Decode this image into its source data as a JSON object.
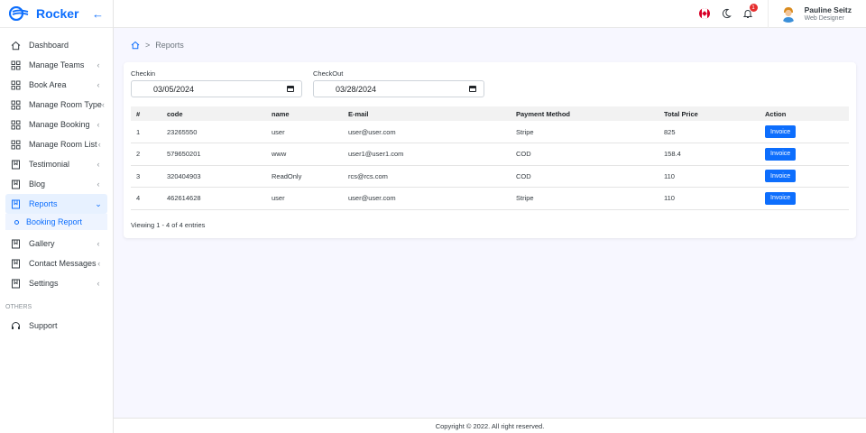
{
  "brand": {
    "name": "Rocker",
    "color": "#0d6efd"
  },
  "sidebar": {
    "items": [
      {
        "label": "Dashboard",
        "icon": "home-icon",
        "arrow": false
      },
      {
        "label": "Manage Teams",
        "icon": "grid-icon",
        "arrow": true
      },
      {
        "label": "Book Area",
        "icon": "grid-icon",
        "arrow": true
      },
      {
        "label": "Manage Room Type",
        "icon": "grid-icon",
        "arrow": true
      },
      {
        "label": "Manage Booking",
        "icon": "grid-icon",
        "arrow": true
      },
      {
        "label": "Manage Room List",
        "icon": "grid-icon",
        "arrow": true
      },
      {
        "label": "Testimonial",
        "icon": "bookmark-icon",
        "arrow": true
      },
      {
        "label": "Blog",
        "icon": "bookmark-icon",
        "arrow": true
      },
      {
        "label": "Reports",
        "icon": "bookmark-icon",
        "arrow": true,
        "active": true
      },
      {
        "label": "Gallery",
        "icon": "bookmark-icon",
        "arrow": true
      },
      {
        "label": "Contact Messages",
        "icon": "bookmark-icon",
        "arrow": true
      },
      {
        "label": "Settings",
        "icon": "bookmark-icon",
        "arrow": true
      }
    ],
    "submenu": {
      "label": "Booking Report"
    },
    "section_label": "OTHERS",
    "support": {
      "label": "Support",
      "icon": "headset-icon"
    }
  },
  "topbar": {
    "notification_count": "1",
    "user": {
      "name": "Pauline Seitz",
      "role": "Web Designer"
    }
  },
  "breadcrumb": {
    "current": "Reports"
  },
  "filters": {
    "checkin": {
      "label": "Checkin",
      "value": "03/05/2024"
    },
    "checkout": {
      "label": "CheckOut",
      "value": "03/28/2024"
    }
  },
  "table": {
    "headers": [
      "#",
      "code",
      "name",
      "E-mail",
      "Payment Method",
      "Total Price",
      "Action"
    ],
    "rows": [
      [
        "1",
        "23265550",
        "user",
        "user@user.com",
        "Stripe",
        "825"
      ],
      [
        "2",
        "579650201",
        "www",
        "user1@user1.com",
        "COD",
        "158.4"
      ],
      [
        "3",
        "320404903",
        "ReadOnly",
        "rcs@rcs.com",
        "COD",
        "110"
      ],
      [
        "4",
        "462614628",
        "user",
        "user@user.com",
        "Stripe",
        "110"
      ]
    ],
    "action_label": "Invoice",
    "info": "Viewing 1 - 4 of 4 entries"
  },
  "footer": {
    "text": "Copyright © 2022. All right reserved."
  },
  "colors": {
    "accent": "#0d6efd",
    "badge": "#e62e2e",
    "active_bg": "#e7f1ff"
  }
}
